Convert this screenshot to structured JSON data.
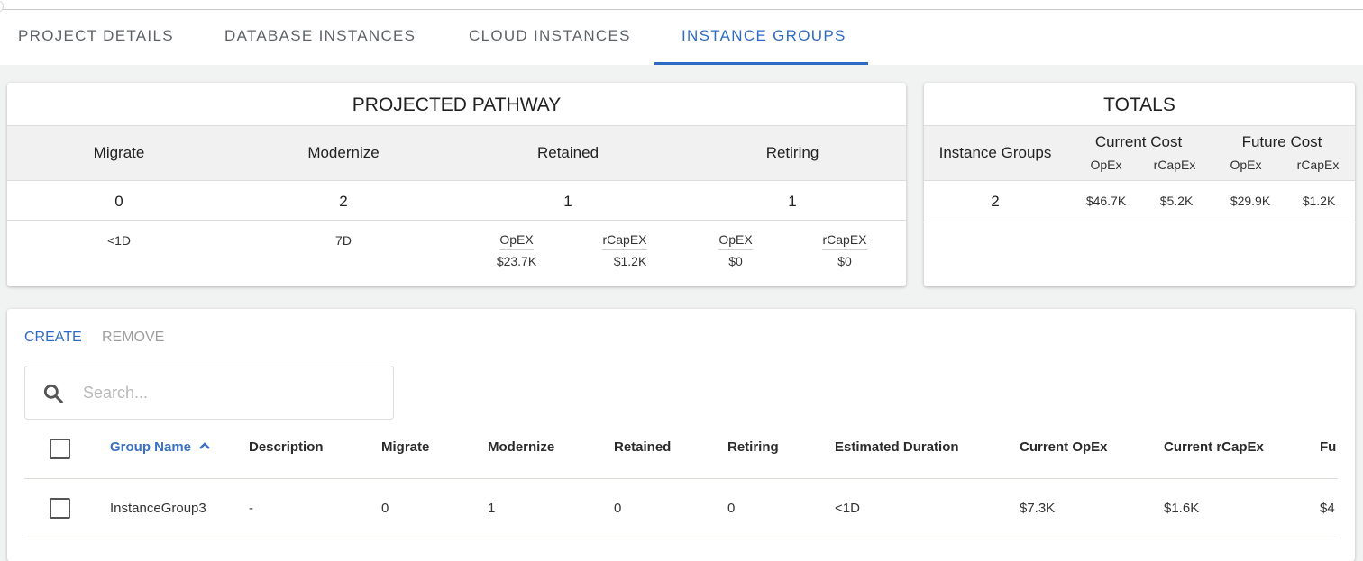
{
  "tabs": [
    {
      "label": "PROJECT DETAILS",
      "active": false
    },
    {
      "label": "DATABASE INSTANCES",
      "active": false
    },
    {
      "label": "CLOUD INSTANCES",
      "active": false
    },
    {
      "label": "INSTANCE GROUPS",
      "active": true
    }
  ],
  "accent_color": "#2e6bc4",
  "pathway": {
    "title": "PROJECTED PATHWAY",
    "columns": [
      "Migrate",
      "Modernize",
      "Retained",
      "Retiring"
    ],
    "counts": [
      "0",
      "2",
      "1",
      "1"
    ],
    "durations": {
      "migrate": "<1D",
      "modernize": "7D"
    },
    "retained": {
      "opex_label": "OpEX",
      "opex_value": "$23.7K",
      "rcapex_label": "rCapEX",
      "rcapex_value": "$1.2K"
    },
    "retiring": {
      "opex_label": "OpEX",
      "opex_value": "$0",
      "rcapex_label": "rCapEX",
      "rcapex_value": "$0"
    }
  },
  "totals": {
    "title": "TOTALS",
    "instance_groups_label": "Instance Groups",
    "current_cost_label": "Current Cost",
    "future_cost_label": "Future Cost",
    "opex_label": "OpEx",
    "rcapex_label": "rCapEx",
    "instance_groups_value": "2",
    "current_opex": "$46.7K",
    "current_rcapex": "$5.2K",
    "future_opex": "$29.9K",
    "future_rcapex": "$1.2K"
  },
  "actions": {
    "create": "CREATE",
    "remove": "REMOVE"
  },
  "search": {
    "placeholder": "Search...",
    "value": ""
  },
  "table": {
    "columns": [
      "Group Name",
      "Description",
      "Migrate",
      "Modernize",
      "Retained",
      "Retiring",
      "Estimated Duration",
      "Current OpEx",
      "Current rCapEx",
      "Fu"
    ],
    "sort": {
      "column": "Group Name",
      "direction": "ascending"
    },
    "rows": [
      {
        "cells": [
          "InstanceGroup3",
          "-",
          "0",
          "1",
          "0",
          "0",
          "<1D",
          "$7.3K",
          "$1.6K",
          "$4"
        ],
        "selected": false
      }
    ]
  }
}
